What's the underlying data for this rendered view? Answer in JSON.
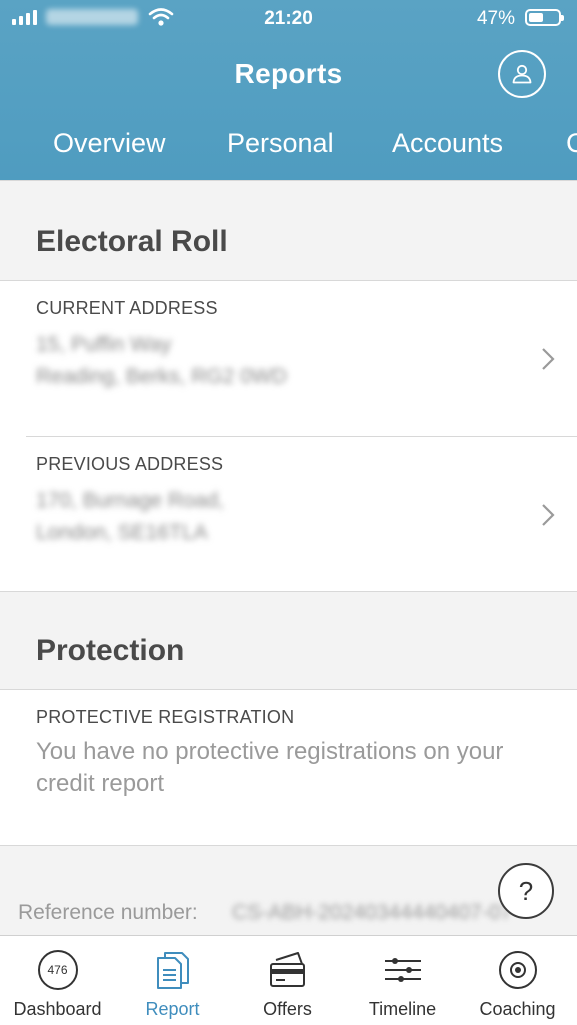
{
  "status_bar": {
    "time": "21:20",
    "battery": "47%",
    "battery_level": 0.47
  },
  "header": {
    "title": "Reports",
    "tabs": [
      "Overview",
      "Personal",
      "Accounts",
      "C"
    ]
  },
  "electoral_roll": {
    "title": "Electoral Roll",
    "current": {
      "label": "CURRENT ADDRESS",
      "line1": "15, Puffin Way",
      "line2": "Reading, Berks, RG2 0WD"
    },
    "previous": {
      "label": "PREVIOUS ADDRESS",
      "line1": "170, Burnage Road,",
      "line2": "London, SE16TLA"
    }
  },
  "protection": {
    "title": "Protection",
    "label": "PROTECTIVE REGISTRATION",
    "description": "You have no protective registrations on your credit report"
  },
  "reference": {
    "label": "Reference number:",
    "value": "CS-ABH-20240344440407-07"
  },
  "help": {
    "label": "?"
  },
  "bottom_nav": {
    "score": "476",
    "items": [
      {
        "label": "Dashboard",
        "icon": "score-ring-icon"
      },
      {
        "label": "Report",
        "icon": "report-icon"
      },
      {
        "label": "Offers",
        "icon": "cards-icon"
      },
      {
        "label": "Timeline",
        "icon": "timeline-icon"
      },
      {
        "label": "Coaching",
        "icon": "target-icon"
      }
    ],
    "active_color": "#3f8dbd"
  },
  "colors": {
    "header": "#5aa3c4",
    "accent": "#3f8dbd",
    "background": "#f3f3f3"
  }
}
